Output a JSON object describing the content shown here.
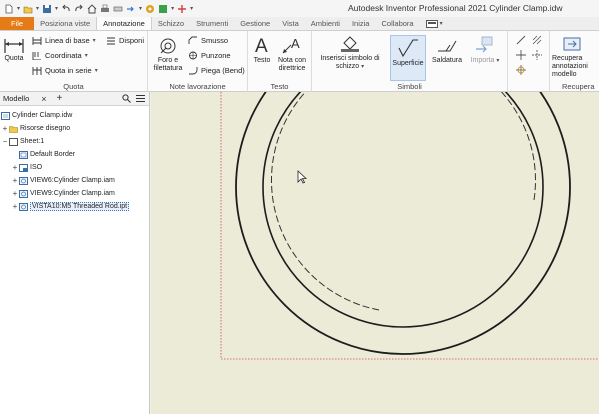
{
  "window": {
    "title": "Autodesk Inventor Professional 2021   Cylinder Clamp.idw"
  },
  "quick_access": [
    "new-icon",
    "open-icon",
    "save-icon",
    "undo-icon",
    "redo-icon",
    "home-icon",
    "print-icon",
    "measure-icon",
    "select-icon",
    "appearance-icon",
    "color-icon",
    "plus-icon"
  ],
  "tabs": [
    {
      "label": "File"
    },
    {
      "label": "Posiziona viste"
    },
    {
      "label": "Annotazione"
    },
    {
      "label": "Schizzo"
    },
    {
      "label": "Strumenti"
    },
    {
      "label": "Gestione"
    },
    {
      "label": "Vista"
    },
    {
      "label": "Ambienti"
    },
    {
      "label": "Inizia"
    },
    {
      "label": "Collabora"
    }
  ],
  "ribbon": {
    "quota": {
      "big": "Quota",
      "items": [
        "Linea di base",
        "Coordinata",
        "Quota in serie"
      ],
      "disponi": "Disponi",
      "label": "Quota"
    },
    "note": {
      "big": "Foro e filettatura",
      "items": [
        "Smusso",
        "Punzone",
        "Piega (Bend)"
      ],
      "label": "Note lavorazione"
    },
    "testo": {
      "big1": "Testo",
      "big2": "Nota con direttrice",
      "label": "Testo"
    },
    "simboli": {
      "inserisci": "Inserisci simbolo di schizzo",
      "superficie": "Superficie",
      "saldatura": "Saldatura",
      "importa": "Importa",
      "label": "Simboli"
    },
    "recupera": {
      "big": "Recupera annotazioni modello",
      "label": "Recupera"
    }
  },
  "browser": {
    "title": "Modello",
    "items": [
      {
        "label": "Cylinder Clamp.idw",
        "expander": ""
      },
      {
        "label": "Risorse disegno",
        "expander": "+"
      },
      {
        "label": "Sheet:1",
        "expander": "−"
      },
      {
        "label": "Default Border",
        "expander": ""
      },
      {
        "label": "ISO",
        "expander": "+"
      },
      {
        "label": "VIEW6:Cylinder Clamp.iam",
        "expander": "+"
      },
      {
        "label": "VIEW9:Cylinder Clamp.iam",
        "expander": "+"
      },
      {
        "label": "VISTA10:M5 Threaded Rod.ipt",
        "expander": "+"
      }
    ]
  }
}
